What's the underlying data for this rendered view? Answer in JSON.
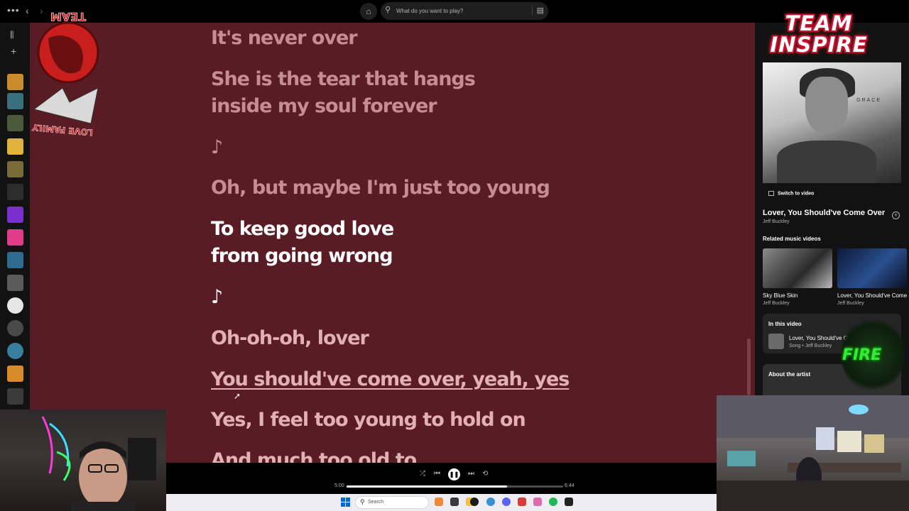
{
  "search": {
    "placeholder": "What do you want to play?"
  },
  "lyrics": [
    {
      "text": "It's never over",
      "state": "past"
    },
    {
      "text": "She is the tear that hangs\ninside my soul forever",
      "state": "past"
    },
    {
      "text": "♪",
      "state": "past"
    },
    {
      "text": "Oh, but maybe I'm just too young",
      "state": "past"
    },
    {
      "text": "To keep good love\nfrom going wrong",
      "state": "current"
    },
    {
      "text": "♪",
      "state": "current"
    },
    {
      "text": "Oh-oh-oh, lover",
      "state": "future"
    },
    {
      "text": "You should've come over, yeah, yes",
      "state": "future"
    },
    {
      "text": "Yes, I feel too young to hold on",
      "state": "future"
    },
    {
      "text": "And much too old to",
      "state": "future"
    }
  ],
  "now_playing": {
    "switch_to_video": "Switch to video",
    "title": "Lover, You Should've Come Over",
    "artist": "Jeff Buckley",
    "cover_text": "GRACE"
  },
  "related": {
    "heading": "Related music videos",
    "items": [
      {
        "title": "Sky Blue Skin",
        "artist": "Jeff Buckley"
      },
      {
        "title": "Lover, You Should've Come Over",
        "artist": "Jeff Buckley"
      }
    ]
  },
  "in_this_video": {
    "heading": "In this video",
    "title": "Lover, You Should've Come Over",
    "subtitle": "Song • Jeff Buckley"
  },
  "about_artist": {
    "heading": "About the artist"
  },
  "player": {
    "elapsed": "5:00",
    "duration": "6:44",
    "progress": 0.74
  },
  "overlays": {
    "brand_right": "TEAM\nINSPIRE",
    "brand_left": "TEAM INSPIRE LOVE FAMILY",
    "fire_badge": "FIRE"
  },
  "taskbar": {
    "search_label": "Search"
  },
  "colors": {
    "lyrics_background": "#591b24",
    "lyric_past": "#c58e93",
    "lyric_current": "#ffffff",
    "lyric_future": "#e2b1b4",
    "spotify_green": "#1db954"
  }
}
